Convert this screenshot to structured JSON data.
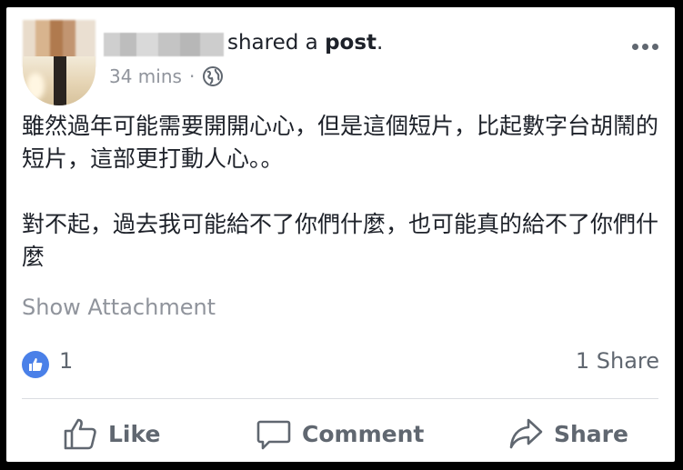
{
  "post": {
    "headline_suffix": "shared a",
    "headline_object": "post",
    "headline_end": ".",
    "timestamp": "34 mins",
    "separator": "·",
    "audience_icon": "globe-icon",
    "body": "雖然過年可能需要開開心心，但是這個短片，比起數字台胡鬧的短片，這部更打動人心。。\n\n對不起，過去我可能給不了你們什麼，也可能真的給不了你們什麼",
    "show_attachment": "Show Attachment"
  },
  "reactions": {
    "like_count": "1",
    "share_count": "1 Share"
  },
  "actions": {
    "like": "Like",
    "comment": "Comment",
    "share": "Share"
  },
  "colors": {
    "like_badge": "#4a80e8",
    "text": "#1d2129",
    "muted": "#90949c",
    "action": "#606770"
  }
}
